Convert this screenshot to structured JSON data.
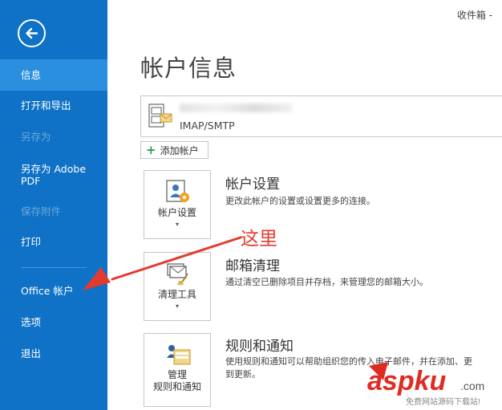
{
  "header": {
    "mailbox": "收件箱 -"
  },
  "page": {
    "title": "帐户信息"
  },
  "sidebar": {
    "items": [
      {
        "label": "信息"
      },
      {
        "label": "打开和导出"
      },
      {
        "label": "另存为"
      },
      {
        "label": "另存为 Adobe\nPDF"
      },
      {
        "label": "保存附件"
      },
      {
        "label": "打印"
      },
      {
        "label": "Office 帐户"
      },
      {
        "label": "选项"
      },
      {
        "label": "退出"
      }
    ]
  },
  "account": {
    "type": "IMAP/SMTP",
    "add_label": "添加帐户"
  },
  "sections": [
    {
      "button": "帐户设置",
      "title": "帐户设置",
      "desc": "更改此帐户的设置或设置更多的连接。"
    },
    {
      "button": "清理工具",
      "title": "邮箱清理",
      "desc": "通过清空已删除项目并存档，来管理您的邮箱大小。"
    },
    {
      "button": "管理\n规则和通知",
      "title": "规则和通知",
      "desc": "使用规则和通知可以帮助组织您的传入电子邮件，并在添加、更",
      "desc2": "到更新。"
    }
  ],
  "annotation": {
    "text": "这里"
  },
  "watermark": {
    "brand": "aspku",
    "suffix": ".com",
    "tagline": "免费网站源码下载站!"
  },
  "colors": {
    "sidebar": "#0f72c6",
    "sidebar_active": "#2b8fe0",
    "annotation": "#e43b2f"
  }
}
